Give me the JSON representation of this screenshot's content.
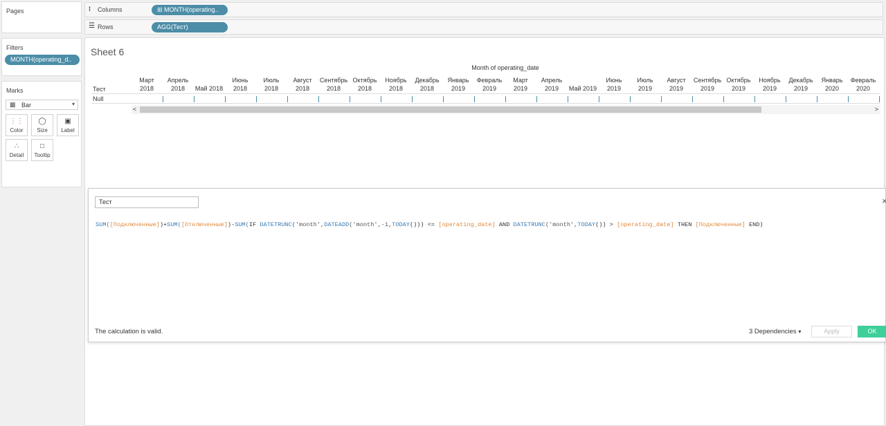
{
  "left_panel": {
    "pages_title": "Pages",
    "filters_title": "Filters",
    "filter_pill": "MONTH(operating_d..",
    "marks_title": "Marks",
    "mark_type": "Bar",
    "mark_buttons": [
      {
        "label": "Color",
        "icon": "color-icon"
      },
      {
        "label": "Size",
        "icon": "size-icon"
      },
      {
        "label": "Label",
        "icon": "label-icon"
      },
      {
        "label": "Detail",
        "icon": "detail-icon"
      },
      {
        "label": "Tooltip",
        "icon": "tooltip-icon"
      }
    ]
  },
  "shelves": {
    "columns_label": "Columns",
    "columns_pill": "MONTH(operating..",
    "rows_label": "Rows",
    "rows_pill": "AGG(Тест)"
  },
  "sheet": {
    "title": "Sheet 6",
    "column_header": "Month of operating_date",
    "row_header": "Тест",
    "row_value": "Null",
    "months": [
      [
        "Март",
        "2018"
      ],
      [
        "Апрель",
        "2018"
      ],
      [
        "Май 2018",
        ""
      ],
      [
        "Июнь",
        "2018"
      ],
      [
        "Июль",
        "2018"
      ],
      [
        "Август",
        "2018"
      ],
      [
        "Сентябрь",
        "2018"
      ],
      [
        "Октябрь",
        "2018"
      ],
      [
        "Ноябрь",
        "2018"
      ],
      [
        "Декабрь",
        "2018"
      ],
      [
        "Январь",
        "2019"
      ],
      [
        "Февраль",
        "2019"
      ],
      [
        "Март",
        "2019"
      ],
      [
        "Апрель",
        "2019"
      ],
      [
        "Май 2019",
        ""
      ],
      [
        "Июнь",
        "2019"
      ],
      [
        "Июль",
        "2019"
      ],
      [
        "Август",
        "2019"
      ],
      [
        "Сентябрь",
        "2019"
      ],
      [
        "Октябрь",
        "2019"
      ],
      [
        "Ноябрь",
        "2019"
      ],
      [
        "Декабрь",
        "2019"
      ],
      [
        "Январь",
        "2020"
      ],
      [
        "Февраль",
        "2020"
      ]
    ]
  },
  "calc_editor": {
    "name_value": "Тест",
    "formula_tokens": [
      {
        "t": "SUM(",
        "c": "fn"
      },
      {
        "t": "[Подключенные]",
        "c": "fd"
      },
      {
        "t": ")+",
        "c": "tx"
      },
      {
        "t": "SUM(",
        "c": "fn"
      },
      {
        "t": "[Отключенные]",
        "c": "fd"
      },
      {
        "t": ")-",
        "c": "tx"
      },
      {
        "t": "SUM(",
        "c": "fn"
      },
      {
        "t": "IF ",
        "c": "tx"
      },
      {
        "t": "DATETRUNC",
        "c": "fn"
      },
      {
        "t": "('month',",
        "c": "st"
      },
      {
        "t": "DATEADD",
        "c": "fn"
      },
      {
        "t": "('month',-1,",
        "c": "st"
      },
      {
        "t": "TODAY",
        "c": "fn"
      },
      {
        "t": "())) <= ",
        "c": "tx"
      },
      {
        "t": "[operating_date]",
        "c": "fd"
      },
      {
        "t": " AND ",
        "c": "tx"
      },
      {
        "t": "DATETRUNC",
        "c": "fn"
      },
      {
        "t": "('month',",
        "c": "st"
      },
      {
        "t": "TODAY",
        "c": "fn"
      },
      {
        "t": "()) > ",
        "c": "tx"
      },
      {
        "t": "[operating_date]",
        "c": "fd"
      },
      {
        "t": " THEN ",
        "c": "tx"
      },
      {
        "t": "[Подключенные]",
        "c": "fd"
      },
      {
        "t": " END)",
        "c": "tx"
      }
    ],
    "status": "The calculation is valid.",
    "dependencies": "3 Dependencies",
    "apply_label": "Apply",
    "ok_label": "OK",
    "close_glyph": "×"
  },
  "colors": {
    "pill": "#4c8da7",
    "ok_button": "#3ecf9a",
    "function": "#3a7bb5",
    "field": "#e08a3c"
  }
}
